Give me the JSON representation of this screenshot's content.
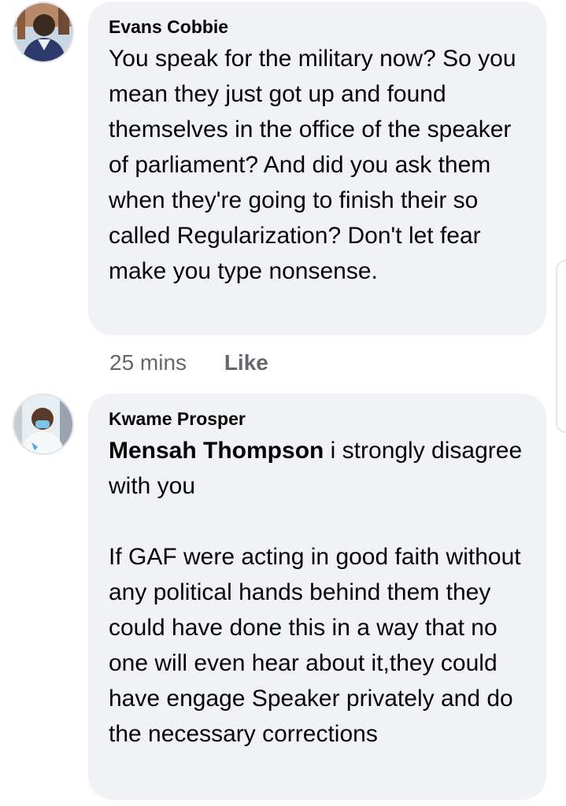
{
  "comments": [
    {
      "author": "Evans Cobbie",
      "text": "You speak for the military now? So you mean they just got up and found themselves in the office of the speaker of parliament? And did you ask them when they're going to finish their so called Regularization? Don't let fear make you type nonsense.",
      "time": "25 mins",
      "like_label": "Like"
    },
    {
      "author": "Kwame Prosper",
      "mention": "Mensah Thompson",
      "text": " i strongly disagree with you\n\nIf GAF were acting in good faith without any political hands behind them they could have done this in a way that no one will even hear about it,they could have engage Speaker privately and do the necessary corrections"
    }
  ]
}
